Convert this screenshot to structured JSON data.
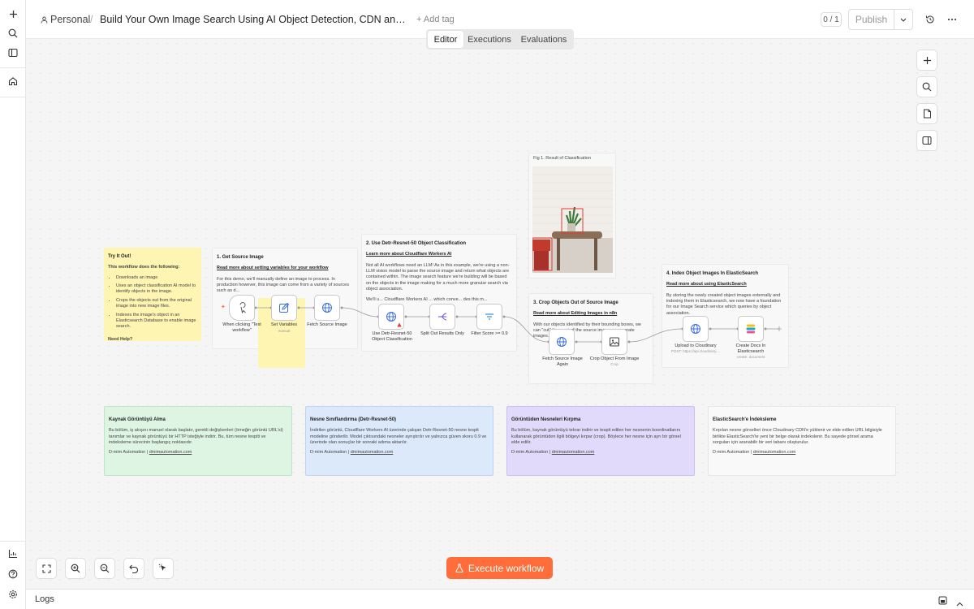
{
  "header": {
    "project": "Personal",
    "separator": "/",
    "workflow_title": "Build Your Own Image Search Using AI Object Detection, CDN and Elastic...",
    "add_tag": "+ Add tag",
    "counter": "0 / 1",
    "publish": "Publish"
  },
  "tabs": [
    "Editor",
    "Executions",
    "Evaluations"
  ],
  "sticky_intro": {
    "title": "Try It Out!",
    "subtitle": "This workflow does the following:",
    "items": [
      "Downloads an image",
      "Uses an object classification AI model to identify objects in the image.",
      "Crops the objects out from the original image into new image files.",
      "Indexes the image's object in an Elasticsearch Database to enable image search."
    ],
    "help": "Need Help?"
  },
  "sticky1": {
    "title": "1. Get Source Image",
    "link": "Read more about setting variables for your workflow",
    "body": "For this demo, we'll manually define an image to process. In production however, this image can come from a variety of sources such as d..."
  },
  "sticky2": {
    "title": "2. Use Detr-Resnet-50 Object Classification",
    "link": "Learn more about Cloudflare Workers AI",
    "body": "Not all AI workflows need an LLM! As in this example, we're using a non-LLM vision model to parse the source image and return what objects are contained within. The image search feature we're building will be based on the objects in the image making for a much more granular search via object association.",
    "body2": "We'll u... Cloudflare Workers AI ... which conve... des this m..."
  },
  "sticky_fig": {
    "caption": "Fig 1. Result of Classification"
  },
  "sticky3": {
    "title": "3. Crop Objects Out of Source Image",
    "link": "Read more about Editing Images in n8n",
    "body": "With our objects identified by their bounding boxes, we can \"cut\" them out of the source image as separate images."
  },
  "sticky4": {
    "title": "4. Index Object Images In ElasticSearch",
    "link": "Read more about using ElasticSearch",
    "body": "By storing the newly created object images externally and indexing them in Elasticsearch, we now have a foundation for our Image Search service which queries by object association."
  },
  "nodes": {
    "trigger": "When clicking \"Test workflow\"",
    "set_vars": "Set Variables",
    "set_vars_sub": "manual",
    "fetch": "Fetch Source Image",
    "detr": "Use Detr-Resnet-50 Object Classification",
    "split": "Split Out Results Only",
    "filter": "Filter Score >= 0.9",
    "fetch_again": "Fetch Source Image Again",
    "crop": "Crop Object From Image",
    "crop_sub": "Crop",
    "upload": "Upload to Cloudinary",
    "upload_sub": "POST: https://api.cloudinary....",
    "create_docs": "Create Docs In Elasticsearch",
    "create_docs_sub": "create: document"
  },
  "notes_tr": [
    {
      "title": "Kaynak Görüntüyü Alma",
      "body": "Bu bölüm, iş akışını manuel olarak başlatır, gerekli değişkenleri (örneğin görüntü URL'si) tanımlar ve kaynak görüntüyü bir HTTP isteğiyle indirir. Bu, tüm nesne tespiti ve indeksleme sürecinin başlangıç noktasıdır.",
      "footer": "D-mim Automation | ",
      "footer_link": "dmimautomation.com"
    },
    {
      "title": "Nesne Sınıflandırma (Detr-Resnet-50)",
      "body": "İndirilen görüntü, Cloudflare Workers AI üzerinde çalışan Detr-Resnet-50 nesne tespit modeline gönderilir. Model çıktısındaki nesneler ayrıştırılır ve yalnızca güven skoru 0.9 ve üzerinde olan sonuçlar bir sonraki adıma aktarılır.",
      "footer": "D-mim Automation | ",
      "footer_link": "dmimautomation.com"
    },
    {
      "title": "Görüntüden Nesneleri Kırpma",
      "body": "Bu bölüm, kaynak görüntüyü tekrar indirir ve tespit edilen her nesnenin koordinatlarını kullanarak görüntüden ilgili bölgeyi kırpar (crop). Böylece her nesne için ayrı bir görsel elde edilir.",
      "footer": "D-mim Automation | ",
      "footer_link": "dmimautomation.com"
    },
    {
      "title": "ElasticSearch'e İndeksleme",
      "body": "Kırpılan nesne görselleri önce Cloudinary CDN'e yüklenir ve elde edilen URL bilgisiyle birlikte ElasticSearch'te yeni bir belge olarak indekslenir. Bu sayede görsel arama sorguları için aranabilir bir veri tabanı oluşturulur.",
      "footer": "D-mim Automation | ",
      "footer_link": "dmimautomation.com"
    }
  ],
  "execute": "Execute workflow",
  "logs": "Logs",
  "colors": {
    "accent": "#ff6d3a",
    "sticky_yellow": "#fff5b2",
    "note_green": "#dff5e3",
    "note_blue": "#dbe9fb",
    "note_purple": "#e2dafa",
    "note_gray": "#f9f9f9"
  }
}
